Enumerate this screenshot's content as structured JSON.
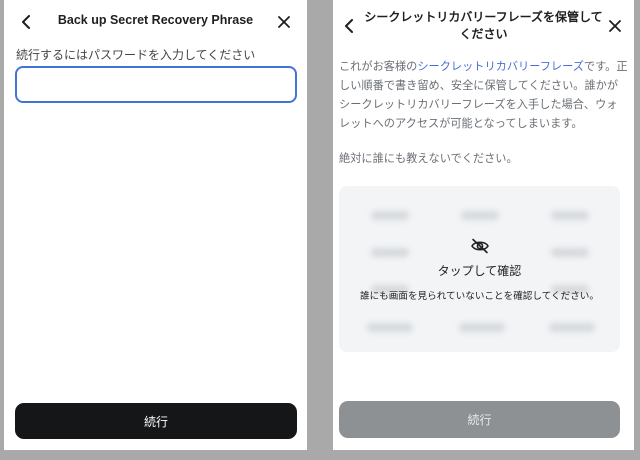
{
  "password_screen": {
    "title": "Back up Secret Recovery Phrase",
    "back_icon": "chevron-left-icon",
    "close_icon": "close-icon",
    "password_label": "続行するにはパスワードを入力してください",
    "password_value": "",
    "password_placeholder": "",
    "continue_label": "続行"
  },
  "reveal_screen": {
    "title": "シークレットリカバリーフレーズを保管してください",
    "back_icon": "chevron-left-icon",
    "close_icon": "close-icon",
    "description_prefix": "これがお客様の",
    "description_link": "シークレットリカバリーフレーズ",
    "description_suffix": "です。正しい順番で書き留め、安全に保管してください。誰かがシークレットリカバリーフレーズを入手した場合、ウォレットへのアクセスが可能となってしまいます。",
    "warning": "絶対に誰にも教えないでください。",
    "eye_icon": "eye-off-icon",
    "tap_label": "タップして確認",
    "privacy_note": "誰にも画面を見られていないことを確認してください。",
    "continue_label": "続行",
    "continue_enabled": false
  },
  "colors": {
    "accent_blue": "#4473d6",
    "link_blue": "#4a6fd8",
    "dark_button": "#141618",
    "disabled_button": "#8e9194",
    "backdrop": "#a9a9a9"
  }
}
